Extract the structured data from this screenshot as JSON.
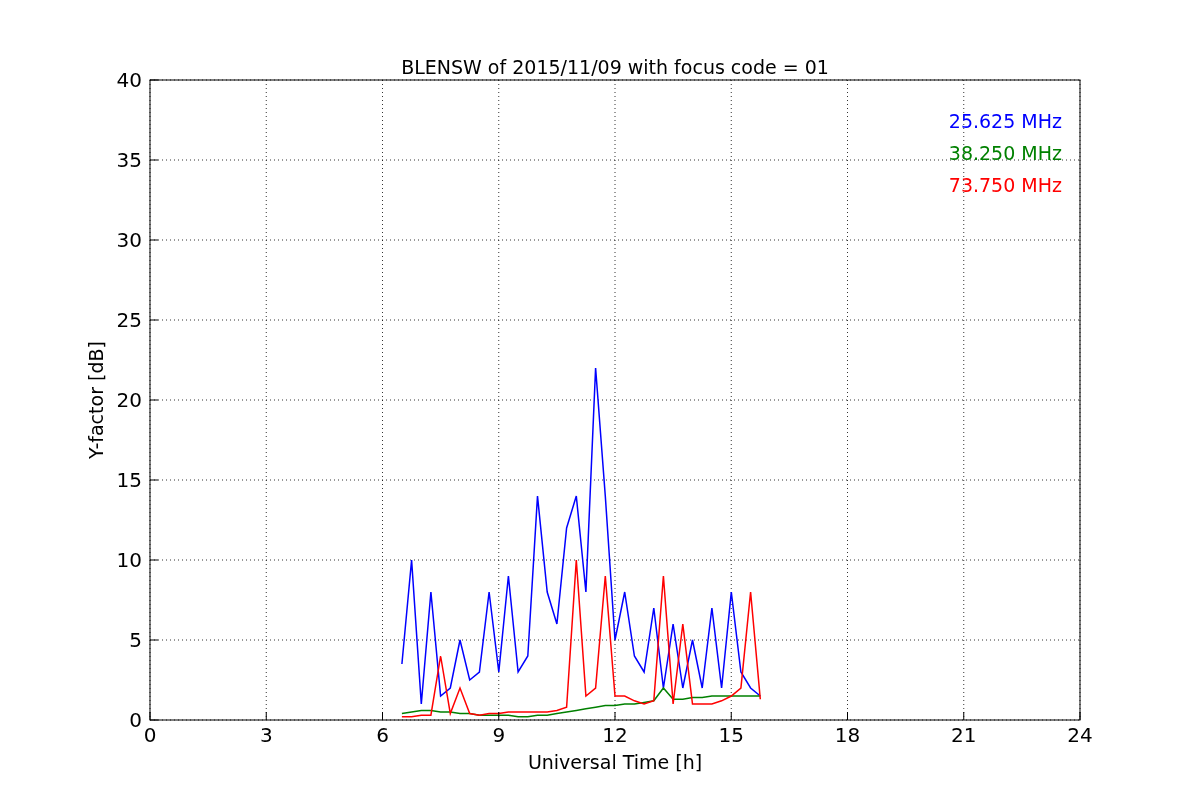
{
  "chart_data": {
    "type": "line",
    "title": "BLENSW of 2015/11/09 with focus code = 01",
    "xlabel": "Universal Time [h]",
    "ylabel": "Y-factor [dB]",
    "x": [
      6.5,
      6.75,
      7,
      7.25,
      7.5,
      7.75,
      8,
      8.25,
      8.5,
      8.75,
      9,
      9.25,
      9.5,
      9.75,
      10,
      10.25,
      10.5,
      10.75,
      11,
      11.25,
      11.5,
      11.75,
      12,
      12.25,
      12.5,
      12.75,
      13,
      13.25,
      13.5,
      13.75,
      14,
      14.25,
      14.5,
      14.75,
      15,
      15.25,
      15.5,
      15.75
    ],
    "series": [
      {
        "name": "25.625 MHz",
        "color": "#0000ff",
        "values": [
          3.5,
          10,
          1,
          8,
          1.5,
          2,
          5,
          2.5,
          3,
          8,
          3,
          9,
          3,
          4,
          14,
          8,
          6,
          12,
          14,
          8,
          22,
          14,
          5,
          8,
          4,
          3,
          7,
          2,
          6,
          2,
          5,
          2,
          7,
          2,
          8,
          3,
          2,
          1.5
        ]
      },
      {
        "name": "38.250 MHz",
        "color": "#008000",
        "values": [
          0.4,
          0.5,
          0.6,
          0.6,
          0.5,
          0.5,
          0.4,
          0.4,
          0.3,
          0.3,
          0.3,
          0.3,
          0.2,
          0.2,
          0.3,
          0.3,
          0.4,
          0.5,
          0.6,
          0.7,
          0.8,
          0.9,
          0.9,
          1,
          1,
          1.1,
          1.2,
          2,
          1.3,
          1.3,
          1.4,
          1.4,
          1.5,
          1.5,
          1.5,
          1.5,
          1.5,
          1.5
        ]
      },
      {
        "name": "73.750 MHz",
        "color": "#ff0000",
        "values": [
          0.2,
          0.2,
          0.3,
          0.3,
          4,
          0.4,
          2,
          0.4,
          0.3,
          0.4,
          0.4,
          0.5,
          0.5,
          0.5,
          0.5,
          0.5,
          0.6,
          0.8,
          10,
          1.5,
          2,
          9,
          1.5,
          1.5,
          1.2,
          1,
          1.2,
          9,
          1,
          6,
          1,
          1,
          1,
          1.2,
          1.5,
          2,
          8,
          1.3
        ]
      }
    ],
    "xlim": [
      0,
      24
    ],
    "ylim": [
      0,
      40
    ],
    "xticks": [
      0,
      3,
      6,
      9,
      12,
      15,
      18,
      21,
      24
    ],
    "yticks": [
      0,
      5,
      10,
      15,
      20,
      25,
      30,
      35,
      40
    ],
    "grid": true
  }
}
